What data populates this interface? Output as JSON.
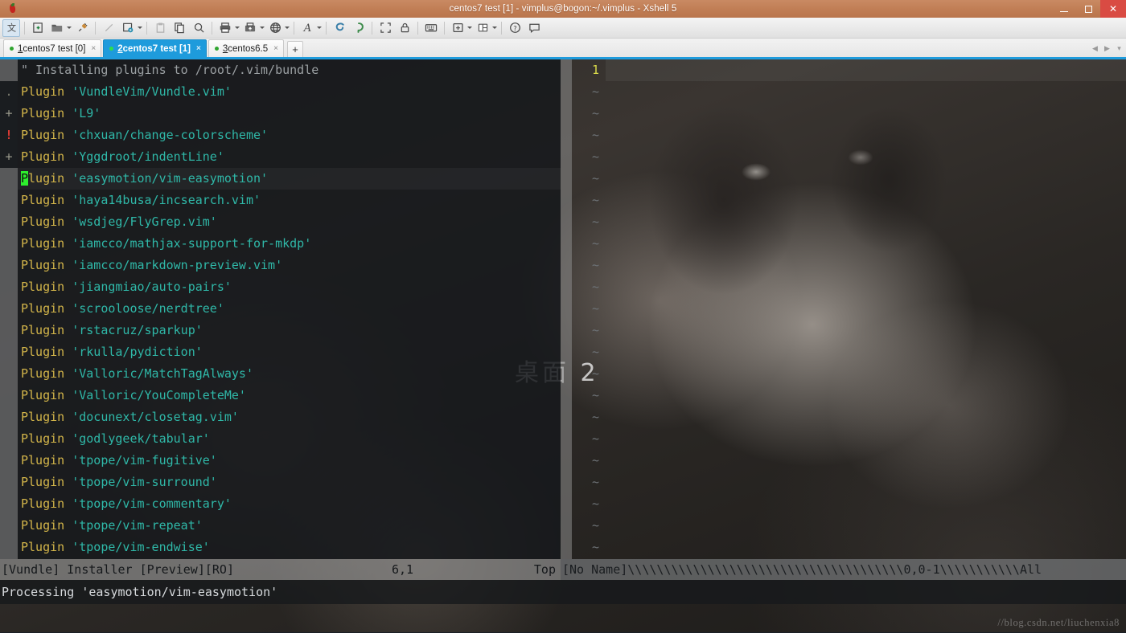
{
  "window": {
    "title": "centos7 test [1] - vimplus@bogon:~/.vimplus - Xshell 5",
    "logo_icon": "xshell-logo-icon",
    "minimize_label": "",
    "maximize_label": "",
    "close_label": "✕"
  },
  "toolbar": {
    "items": [
      {
        "name": "transfer-file-icon",
        "icon": "cjk-text",
        "caret": false,
        "active": true,
        "dim": false
      },
      {
        "name": "new-session-icon",
        "icon": "new-doc",
        "caret": false,
        "active": false,
        "dim": false
      },
      {
        "name": "open-session-icon",
        "icon": "folder",
        "caret": true,
        "active": false,
        "dim": false
      },
      {
        "name": "connect-icon",
        "icon": "plug",
        "caret": false,
        "active": false,
        "dim": false
      },
      {
        "name": "disconnect-icon",
        "icon": "plug-off",
        "caret": false,
        "active": false,
        "dim": true
      },
      {
        "name": "session-properties-icon",
        "icon": "gear-doc",
        "caret": true,
        "active": false,
        "dim": false
      },
      {
        "name": "paste-plain-icon",
        "icon": "clipboard",
        "caret": false,
        "active": false,
        "dim": true
      },
      {
        "name": "copy-icon",
        "icon": "copy",
        "caret": false,
        "active": false,
        "dim": false
      },
      {
        "name": "find-icon",
        "icon": "magnifier",
        "caret": false,
        "active": false,
        "dim": false
      },
      {
        "name": "print-icon",
        "icon": "printer",
        "caret": true,
        "active": false,
        "dim": false
      },
      {
        "name": "file-transfer-icon",
        "icon": "transfer",
        "caret": true,
        "active": false,
        "dim": false
      },
      {
        "name": "tunnel-icon",
        "icon": "globe",
        "caret": true,
        "active": false,
        "dim": false
      },
      {
        "name": "font-size-icon",
        "icon": "letter-a",
        "caret": true,
        "active": false,
        "dim": false
      },
      {
        "name": "xftp-icon",
        "icon": "xftp",
        "caret": false,
        "active": false,
        "dim": false
      },
      {
        "name": "xagent-icon",
        "icon": "xagent",
        "caret": false,
        "active": false,
        "dim": false
      },
      {
        "name": "full-screen-icon",
        "icon": "expand",
        "caret": false,
        "active": false,
        "dim": false
      },
      {
        "name": "lock-icon",
        "icon": "lock",
        "caret": false,
        "active": false,
        "dim": false
      },
      {
        "name": "keyboard-icon",
        "icon": "keyboard",
        "caret": false,
        "active": false,
        "dim": false
      },
      {
        "name": "add-pane-icon",
        "icon": "add-box",
        "caret": true,
        "active": false,
        "dim": false
      },
      {
        "name": "layout-icon",
        "icon": "layout",
        "caret": true,
        "active": false,
        "dim": false
      },
      {
        "name": "help-icon",
        "icon": "question",
        "caret": false,
        "active": false,
        "dim": false
      },
      {
        "name": "feedback-icon",
        "icon": "speech",
        "caret": false,
        "active": false,
        "dim": false
      }
    ]
  },
  "tabs": {
    "items": [
      {
        "num": "1",
        "label": "centos7 test [0]",
        "selected": false,
        "status": "connected"
      },
      {
        "num": "2",
        "label": "centos7 test [1]",
        "selected": true,
        "status": "connected"
      },
      {
        "num": "3",
        "label": "centos6.5",
        "selected": false,
        "status": "connected"
      }
    ],
    "add_label": "+",
    "close_glyph": "×",
    "scroll_left": "◀",
    "scroll_right": "▶",
    "menu_glyph": "▾"
  },
  "desktop": {
    "watermark": "桌面 2",
    "blog_watermark": "//blog.csdn.net/liuchenxia8"
  },
  "editor": {
    "signs": [
      {
        "glyph": "",
        "kind": "none"
      },
      {
        "glyph": ".",
        "kind": "dot"
      },
      {
        "glyph": "+",
        "kind": "plus"
      },
      {
        "glyph": "!",
        "kind": "bang"
      },
      {
        "glyph": "+",
        "kind": "plus"
      }
    ],
    "lines": [
      {
        "type": "comment",
        "text": "\" Installing plugins to /root/.vim/bundle"
      },
      {
        "type": "plugin",
        "kw": "Plugin",
        "arg": "'VundleVim/Vundle.vim'"
      },
      {
        "type": "plugin",
        "kw": "Plugin",
        "arg": "'L9'"
      },
      {
        "type": "plugin",
        "kw": "Plugin",
        "arg": "'chxuan/change-colorscheme'"
      },
      {
        "type": "plugin",
        "kw": "Plugin",
        "arg": "'Yggdroot/indentLine'"
      },
      {
        "type": "plugin",
        "kw": "Plugin",
        "arg": "'easymotion/vim-easymotion'",
        "cursor": true
      },
      {
        "type": "plugin",
        "kw": "Plugin",
        "arg": "'haya14busa/incsearch.vim'"
      },
      {
        "type": "plugin",
        "kw": "Plugin",
        "arg": "'wsdjeg/FlyGrep.vim'"
      },
      {
        "type": "plugin",
        "kw": "Plugin",
        "arg": "'iamcco/mathjax-support-for-mkdp'"
      },
      {
        "type": "plugin",
        "kw": "Plugin",
        "arg": "'iamcco/markdown-preview.vim'"
      },
      {
        "type": "plugin",
        "kw": "Plugin",
        "arg": "'jiangmiao/auto-pairs'"
      },
      {
        "type": "plugin",
        "kw": "Plugin",
        "arg": "'scrooloose/nerdtree'"
      },
      {
        "type": "plugin",
        "kw": "Plugin",
        "arg": "'rstacruz/sparkup'"
      },
      {
        "type": "plugin",
        "kw": "Plugin",
        "arg": "'rkulla/pydiction'"
      },
      {
        "type": "plugin",
        "kw": "Plugin",
        "arg": "'Valloric/MatchTagAlways'"
      },
      {
        "type": "plugin",
        "kw": "Plugin",
        "arg": "'Valloric/YouCompleteMe'"
      },
      {
        "type": "plugin",
        "kw": "Plugin",
        "arg": "'docunext/closetag.vim'"
      },
      {
        "type": "plugin",
        "kw": "Plugin",
        "arg": "'godlygeek/tabular'"
      },
      {
        "type": "plugin",
        "kw": "Plugin",
        "arg": "'tpope/vim-fugitive'"
      },
      {
        "type": "plugin",
        "kw": "Plugin",
        "arg": "'tpope/vim-surround'"
      },
      {
        "type": "plugin",
        "kw": "Plugin",
        "arg": "'tpope/vim-commentary'"
      },
      {
        "type": "plugin",
        "kw": "Plugin",
        "arg": "'tpope/vim-repeat'"
      },
      {
        "type": "plugin",
        "kw": "Plugin",
        "arg": "'tpope/vim-endwise'"
      }
    ],
    "cursor_char": "P",
    "cursor_rest": "lugin ",
    "cursor_arg": "'easymotion/vim-easymotion'"
  },
  "right_pane": {
    "line_numbers": [
      "1",
      "~",
      "~",
      "~",
      "~",
      "~",
      "~",
      "~",
      "~",
      "~",
      "~",
      "~",
      "~",
      "~",
      "~",
      "~",
      "~",
      "~",
      "~",
      "~",
      "~",
      "~",
      "~"
    ]
  },
  "status": {
    "left_name": "[Vundle] Installer [Preview][RO]",
    "left_pos": "6,1",
    "left_scroll": "Top",
    "right_text": "[No Name]\\\\\\\\\\\\\\\\\\\\\\\\\\\\\\\\\\\\\\\\\\\\\\\\\\\\\\\\\\\\\\\\\\\\\\\\\\\\0,0-1\\\\\\\\\\\\\\\\\\\\\\All"
  },
  "message": {
    "text": "Processing 'easymotion/vim-easymotion'"
  },
  "colors": {
    "titlebar": "#c07d54",
    "tab_selected": "#1e9bdc",
    "close_button": "#d94b43",
    "keyword": "#d4b64a",
    "string": "#2fb8a8",
    "comment": "#9ba0a3",
    "cursor": "#2ef02e",
    "sign_error": "#e03b34"
  }
}
